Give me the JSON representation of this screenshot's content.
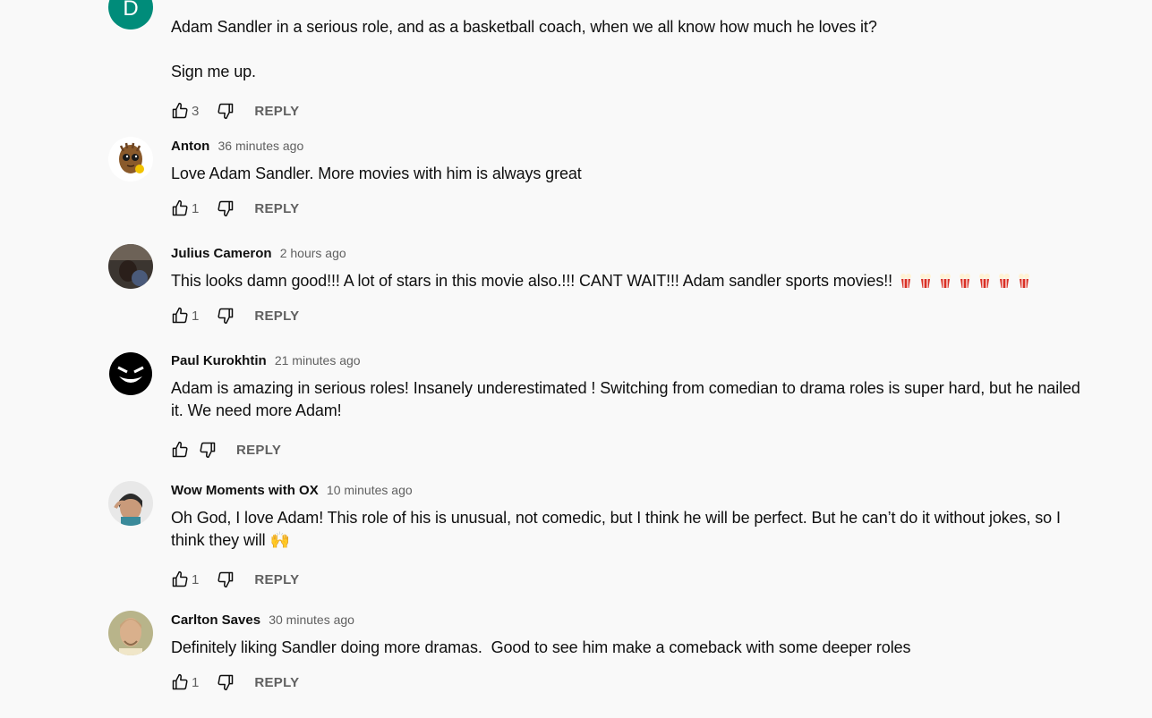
{
  "comments": [
    {
      "author": "",
      "time": "",
      "avatar_letter": "D",
      "avatar_color": "#008c7a",
      "text": "Adam Sandler in a serious role, and as a basketball coach, when we all know how much he loves it?\n\nSign me up.",
      "likes": "3",
      "reply_label": "REPLY"
    },
    {
      "author": "Anton",
      "time": "36 minutes ago",
      "avatar_icon": "groot-avatar",
      "text": "Love Adam Sandler. More movies with him is always great",
      "likes": "1",
      "reply_label": "REPLY"
    },
    {
      "author": "Julius Cameron",
      "time": "2 hours ago",
      "avatar_icon": "photo-avatar",
      "text": "This looks damn good!!! A lot of stars in this movie also.!!! CANT WAIT!!! Adam sandler sports movies!!",
      "text_emoji": "popcorn x7",
      "likes": "1",
      "reply_label": "REPLY"
    },
    {
      "author": "Paul Kurokhtin",
      "time": "21 minutes ago",
      "avatar_icon": "grin-face-avatar",
      "text": "Adam is amazing in serious roles! Insanely underestimated ! Switching from comedian to drama roles is super hard, but he nailed it. We need more Adam!",
      "likes": "",
      "reply_label": "REPLY"
    },
    {
      "author": "Wow Moments with OX",
      "time": "10 minutes ago",
      "avatar_icon": "photo-avatar",
      "text": "Oh God, I love Adam! This role of his is unusual, not comedic, but I think he will be perfect. But he can’t do it without jokes, so I think they will 🙌",
      "likes": "1",
      "reply_label": "REPLY"
    },
    {
      "author": "Carlton Saves",
      "time": "30 minutes ago",
      "avatar_icon": "portrait-avatar",
      "text": "Definitely liking Sandler doing more dramas.  Good to see him make a comeback with some deeper roles",
      "likes": "1",
      "reply_label": "REPLY"
    }
  ]
}
